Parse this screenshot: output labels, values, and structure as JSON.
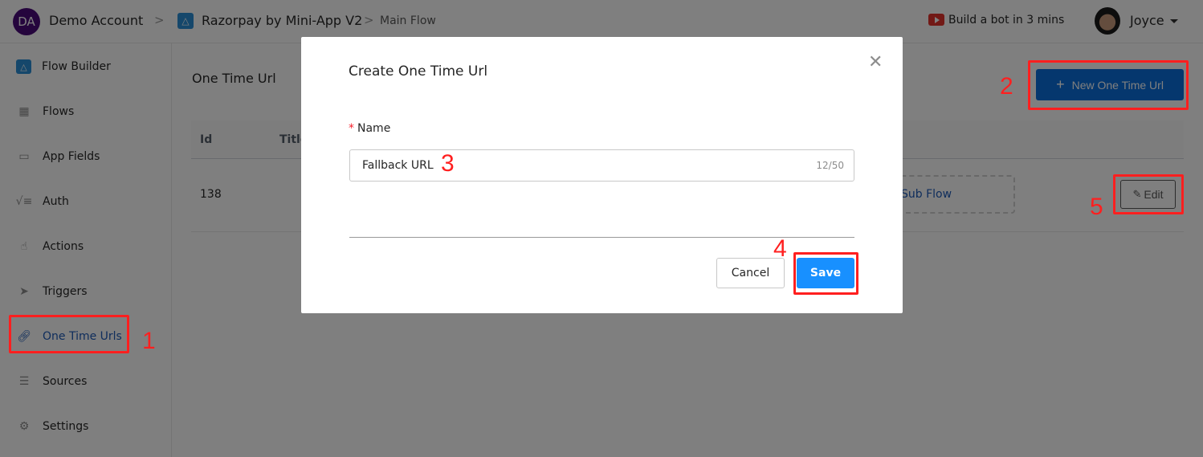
{
  "header": {
    "account_initials": "DA",
    "account_name": "Demo Account",
    "app_name": "Razorpay by Mini-App V2",
    "flow_name": "Main Flow",
    "build_link": "Build a bot in 3 mins",
    "user_name": "Joyce",
    "separator": ">"
  },
  "sidebar": {
    "items": [
      {
        "label": "Flow Builder",
        "icon": "flow-builder-icon"
      },
      {
        "label": "Flows",
        "icon": "grid-icon"
      },
      {
        "label": "App Fields",
        "icon": "fields-icon"
      },
      {
        "label": "Auth",
        "icon": "checklist-icon"
      },
      {
        "label": "Actions",
        "icon": "hand-pointer-icon"
      },
      {
        "label": "Triggers",
        "icon": "send-arrow-icon"
      },
      {
        "label": "One Time Urls",
        "icon": "link-icon",
        "active": true
      },
      {
        "label": "Sources",
        "icon": "document-list-icon"
      },
      {
        "label": "Settings",
        "icon": "gear-icon"
      }
    ]
  },
  "main": {
    "title": "One Time Url",
    "new_button_label": "New One Time Url",
    "table": {
      "columns": [
        "Id",
        "Title"
      ],
      "rows": [
        {
          "id": "138",
          "action_link": "Sub Flow",
          "edit_label": "Edit"
        }
      ]
    }
  },
  "modal": {
    "title": "Create One Time Url",
    "field_label": "Name",
    "required_mark": "*",
    "field_value": "Fallback URL",
    "counter": "12/50",
    "cancel_label": "Cancel",
    "save_label": "Save"
  },
  "annotations": [
    "1",
    "2",
    "3",
    "4",
    "5"
  ],
  "colors": {
    "primary": "#1890ff",
    "brand_dark": "#0a6edc",
    "annotation": "#ff1f1f",
    "account_avatar": "#4a0a7a"
  }
}
